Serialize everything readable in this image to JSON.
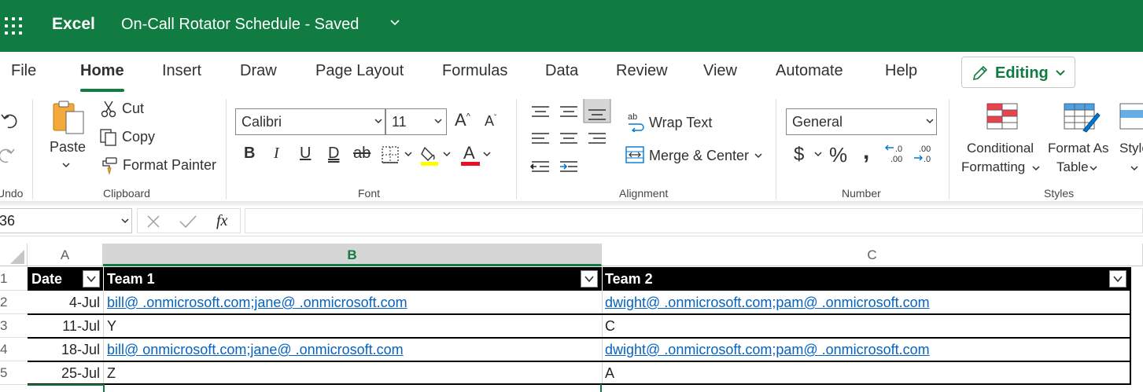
{
  "titlebar": {
    "app_name": "Excel",
    "doc_title": "On-Call Rotator Schedule  -  Saved",
    "bg_color": "#107c41"
  },
  "tabs": [
    "File",
    "Home",
    "Insert",
    "Draw",
    "Page Layout",
    "Formulas",
    "Data",
    "Review",
    "View",
    "Automate",
    "Help"
  ],
  "active_tab": "Home",
  "editing_label": "Editing",
  "ribbon": {
    "undo_label": "Undo",
    "clipboard": {
      "paste": "Paste",
      "cut": "Cut",
      "copy": "Copy",
      "format_painter": "Format Painter",
      "group": "Clipboard"
    },
    "font": {
      "family": "Calibri",
      "size": "11",
      "group": "Font",
      "bold": "B",
      "italic": "I",
      "underline": "U",
      "double_underline": "D",
      "strikethrough": "ab"
    },
    "alignment": {
      "wrap_text": "Wrap Text",
      "merge_center": "Merge & Center",
      "group": "Alignment"
    },
    "number": {
      "format": "General",
      "group": "Number",
      "currency": "$",
      "percent": "%",
      "comma": ","
    },
    "styles": {
      "conditional_line1": "Conditional",
      "conditional_line2": "Formatting",
      "format_as_line1": "Format As",
      "format_as_line2": "Table",
      "cell_styles": "Style",
      "group": "Styles"
    }
  },
  "formula_bar": {
    "name_box": "36",
    "fx": "fx"
  },
  "columns": [
    "A",
    "B",
    "C"
  ],
  "selected_column": "B",
  "rows": [
    "1",
    "2",
    "3",
    "4",
    "5"
  ],
  "table": {
    "headers": [
      "Date",
      "Team 1",
      "Team 2"
    ],
    "data": [
      {
        "date": "4-Jul",
        "team1": "bill@              .onmicrosoft.com;jane@              .onmicrosoft.com",
        "team2": "dwight@              .onmicrosoft.com;pam@              .onmicrosoft.com",
        "link": true
      },
      {
        "date": "11-Jul",
        "team1": "Y",
        "team2": "C",
        "link": false
      },
      {
        "date": "18-Jul",
        "team1": "bill@              onmicrosoft.com;jane@              .onmicrosoft.com",
        "team2": "dwight@              .onmicrosoft.com;pam@              .onmicrosoft.com",
        "link": true
      },
      {
        "date": "25-Jul",
        "team1": "Z",
        "team2": "A",
        "link": false
      }
    ]
  }
}
